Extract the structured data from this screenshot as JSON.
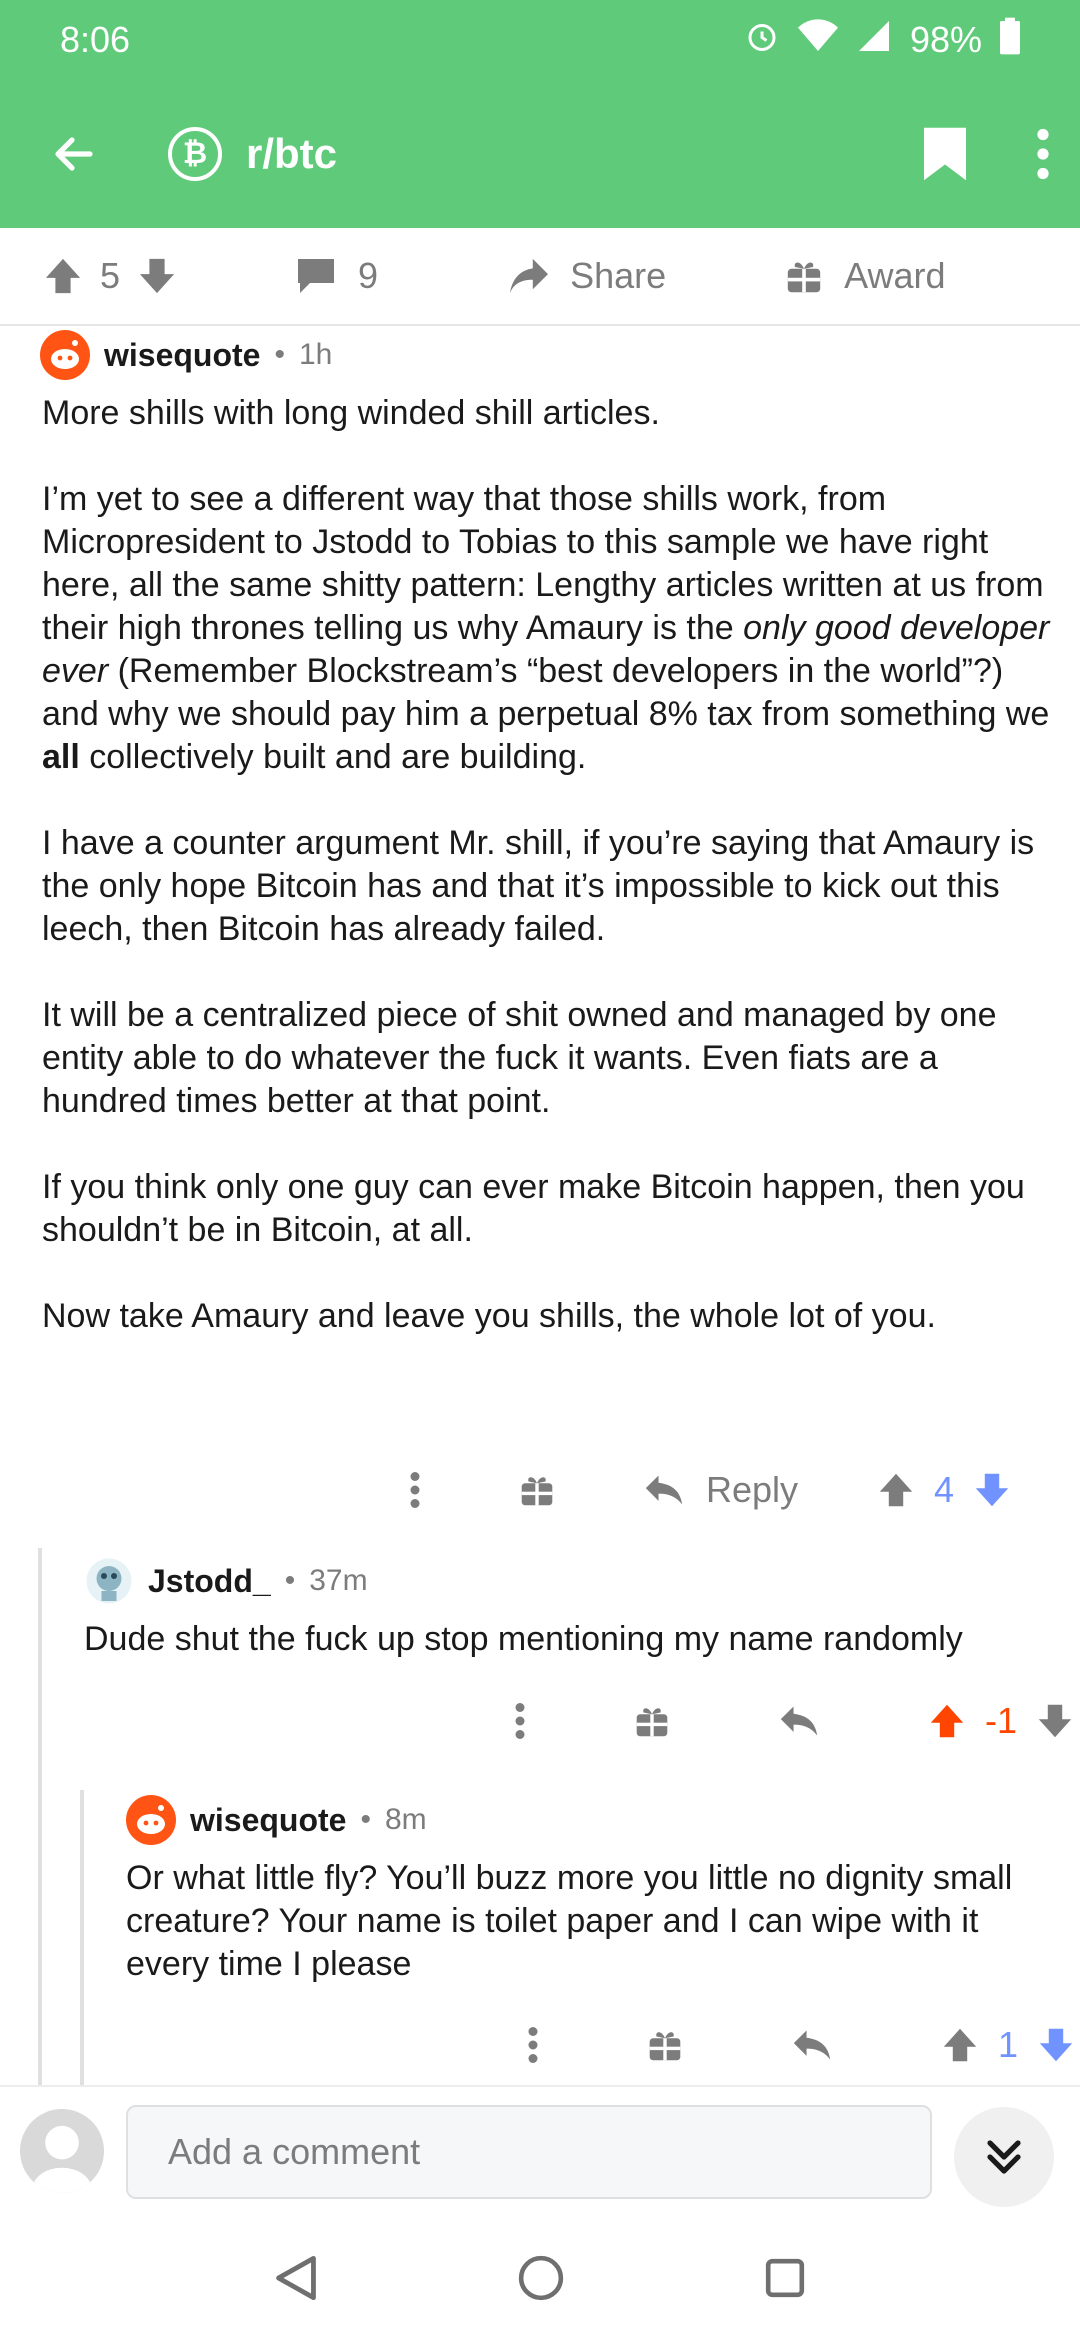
{
  "status": {
    "time": "8:06",
    "battery": "98%"
  },
  "header": {
    "subreddit": "r/btc",
    "badge_symbol": "₿"
  },
  "post_bar": {
    "upvotes": "5",
    "comments": "9",
    "share_label": "Share",
    "award_label": "Award"
  },
  "comments": [
    {
      "author": "wisequote",
      "separator": "•",
      "time": "1h",
      "paragraphs": [
        "More shills with long winded shill articles.",
        "I’m yet to see a different way that those shills work, from Micropresident to Jstodd to Tobias to this sample we have right here, all the same shitty pattern: Lengthy articles written at us from their high thrones telling us why Amaury is the",
        "only good developer ever",
        "(Remember Blockstream’s “best developers in the world”?) and why we should pay him a perpetual 8% tax from something we",
        "all",
        "collectively built and are building.",
        "I have a counter argument Mr. shill, if you’re saying that Amaury is the only hope Bitcoin has and that it’s impossible to kick out this leech, then Bitcoin has already failed.",
        "It will be a centralized piece of shit owned and managed by one entity able to do whatever the fuck it wants. Even fiats are a hundred times better at that point.",
        "If you think only one guy can ever make Bitcoin happen, then you shouldn’t be in Bitcoin, at all.",
        "Now take Amaury and leave you shills, the whole lot of you."
      ],
      "reply_label": "Reply",
      "score": "4"
    },
    {
      "author": "Jstodd_",
      "separator": "•",
      "time": "37m",
      "text": "Dude shut the fuck up stop mentioning my name randomly",
      "score": "-1"
    },
    {
      "author": "wisequote",
      "separator": "•",
      "time": "8m",
      "text": "Or what little fly? You’ll buzz more you little no dignity small creature? Your name is toilet paper and I can wipe with it every time I please",
      "score": "1"
    }
  ],
  "composer": {
    "placeholder": "Add a comment"
  },
  "colors": {
    "header": "#5fca79",
    "upvote_active": "#ff4500",
    "downvote_active": "#7193ff",
    "score_blue": "#7193ff",
    "score_orange": "#ff4500"
  }
}
